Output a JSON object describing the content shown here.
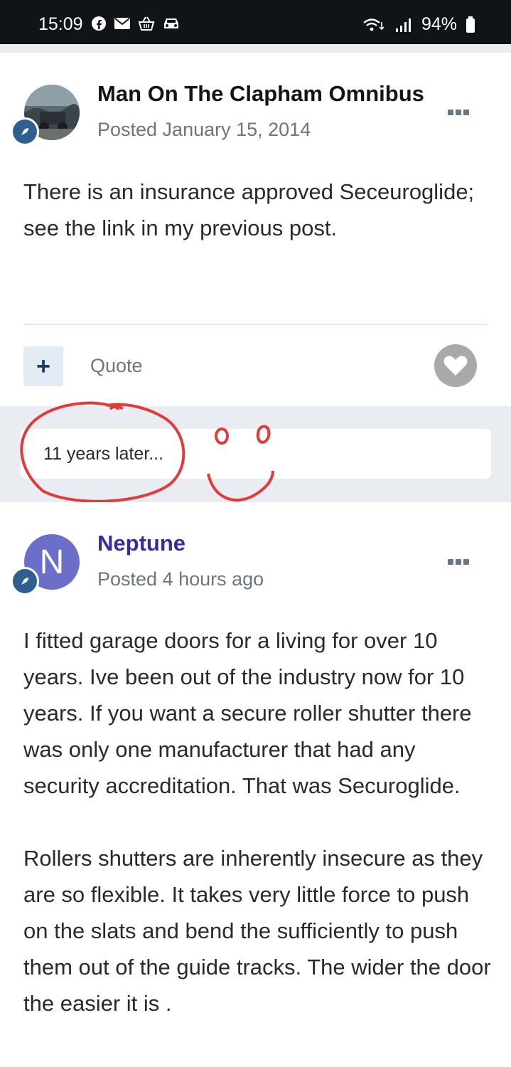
{
  "status_bar": {
    "time": "15:09",
    "battery": "94%",
    "icons": [
      "facebook-icon",
      "mail-icon",
      "basket-icon",
      "car-icon",
      "wifi-icon",
      "signal-icon",
      "battery-icon"
    ]
  },
  "posts": [
    {
      "author": "Man On The Clapham Omnibus",
      "posted": "Posted January 15, 2014",
      "body": [
        "There is an insurance approved Seceuroglide; see the link in my previous post."
      ],
      "actions": {
        "add": "+",
        "quote": "Quote"
      }
    },
    {
      "author": "Neptune",
      "avatar_letter": "N",
      "posted": "Posted 4 hours ago",
      "body": [
        "I fitted garage doors for a living for over 10 years.  Ive been out of the industry now for 10 years.  If you want a secure roller shutter there was only one manufacturer that had any security accreditation. That was Securoglide.",
        "Rollers shutters are inherently insecure as they are so flexible. It takes very little force to push on the slats and bend the sufficiently to push them out of the guide tracks.  The wider the door the easier it is ."
      ]
    }
  ],
  "time_gap": {
    "text": "11 years later..."
  },
  "colors": {
    "accent": "#3a2aa0",
    "badge": "#2f5f8f",
    "annotation": "#e23b3b"
  }
}
